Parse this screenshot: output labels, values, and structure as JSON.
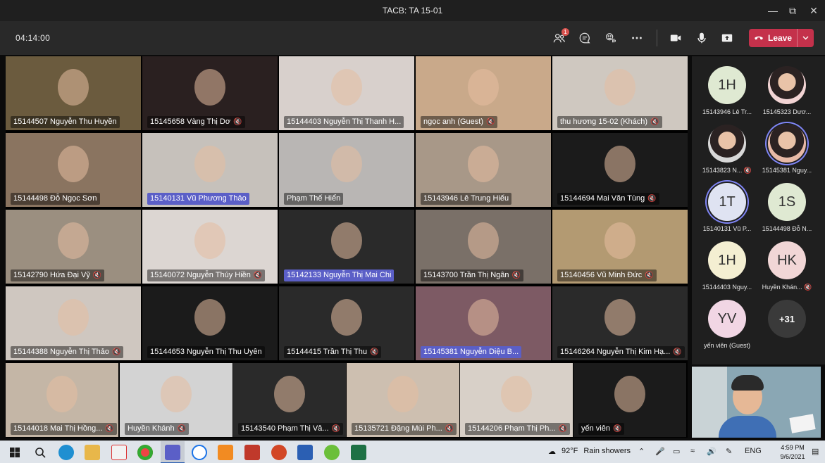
{
  "window": {
    "title": "TACB: TA 15-01"
  },
  "controls": {
    "timer": "04:14:00",
    "participants_badge": "1",
    "leave_label": "Leave"
  },
  "grid": {
    "tiles": [
      {
        "name": "15144507 Nguyễn Thu Huyền",
        "mic": false,
        "highlight": false
      },
      {
        "name": "15145658 Vàng Thị Dơ",
        "mic": true,
        "highlight": false
      },
      {
        "name": "15144403 Nguyễn Thị Thanh H...",
        "mic": false,
        "highlight": false
      },
      {
        "name": "ngọc anh (Guest)",
        "mic": true,
        "highlight": false
      },
      {
        "name": "thu hương 15-02 (Khách)",
        "mic": true,
        "highlight": false
      },
      {
        "name": "15144498 Đỗ Ngọc Sơn",
        "mic": false,
        "highlight": false
      },
      {
        "name": "15140131 Vũ Phương Thảo",
        "mic": false,
        "highlight": true
      },
      {
        "name": "Phạm Thế Hiển",
        "mic": false,
        "highlight": false
      },
      {
        "name": "15143946 Lê Trung Hiếu",
        "mic": false,
        "highlight": false
      },
      {
        "name": "15144694 Mai Văn Tùng",
        "mic": true,
        "highlight": false
      },
      {
        "name": "15142790 Hứa Đại Vỹ",
        "mic": true,
        "highlight": false
      },
      {
        "name": "15140072 Nguyễn Thúy Hiền",
        "mic": true,
        "highlight": false
      },
      {
        "name": "15142133 Nguyễn Thị Mai Chi",
        "mic": false,
        "highlight": true
      },
      {
        "name": "15143700 Trần Thị Ngân",
        "mic": true,
        "highlight": false
      },
      {
        "name": "15140456 Vũ Minh Đức",
        "mic": true,
        "highlight": false
      },
      {
        "name": "15144388 Nguyễn Thị Thảo",
        "mic": true,
        "highlight": false
      },
      {
        "name": "15144653 Nguyễn Thị Thu Uyên",
        "mic": false,
        "highlight": false
      },
      {
        "name": "15144415 Trần Thị Thu",
        "mic": true,
        "highlight": false
      },
      {
        "name": "15145381 Nguyễn Diệu B...",
        "mic": false,
        "highlight": true
      },
      {
        "name": "15146264 Nguyễn Thị Kim Hạ...",
        "mic": true,
        "highlight": false
      },
      {
        "name": "15144018 Mai Thị Hồng...",
        "mic": true,
        "highlight": false
      },
      {
        "name": "Huyền Khánh",
        "mic": true,
        "highlight": false
      },
      {
        "name": "15143540 Phạm Thị Vâ...",
        "mic": true,
        "highlight": false
      },
      {
        "name": "15135721 Đặng Mùi Ph...",
        "mic": true,
        "highlight": false
      },
      {
        "name": "15144206 Phạm Thị Ph...",
        "mic": true,
        "highlight": false
      },
      {
        "name": "yến viên",
        "mic": true,
        "highlight": false
      }
    ]
  },
  "roster": {
    "items": [
      {
        "initials": "1H",
        "label": "15143946 Lê Tr...",
        "color": "#dfe9d2",
        "photo": false,
        "speaking": false,
        "mic": false
      },
      {
        "initials": "",
        "label": "15145323 Dươ...",
        "color": "#f2d4d4",
        "photo": true,
        "speaking": false,
        "mic": false
      },
      {
        "initials": "",
        "label": "15143823 N...",
        "color": "#d8d8d8",
        "photo": true,
        "speaking": false,
        "mic": true
      },
      {
        "initials": "",
        "label": "15145381 Nguy...",
        "color": "#e8b9a6",
        "photo": true,
        "speaking": true,
        "mic": false
      },
      {
        "initials": "1T",
        "label": "15140131 Vũ P...",
        "color": "#dfe3f2",
        "photo": false,
        "speaking": true,
        "mic": false
      },
      {
        "initials": "1S",
        "label": "15144498 Đỗ N...",
        "color": "#dfe9d2",
        "photo": false,
        "speaking": false,
        "mic": false
      },
      {
        "initials": "1H",
        "label": "15144403 Nguy...",
        "color": "#f4efd2",
        "photo": false,
        "speaking": false,
        "mic": false
      },
      {
        "initials": "HK",
        "label": "Huyền Khán...",
        "color": "#f1d6d6",
        "photo": false,
        "speaking": false,
        "mic": true
      },
      {
        "initials": "YV",
        "label": "yến viên (Guest)",
        "color": "#f1d6e4",
        "photo": false,
        "speaking": false,
        "mic": false
      },
      {
        "initials": "+31",
        "label": "",
        "color": "#3a3a3a",
        "photo": false,
        "speaking": false,
        "mic": false
      }
    ]
  },
  "taskbar": {
    "weather_temp": "92°F",
    "weather_text": "Rain showers",
    "language": "ENG",
    "time": "4:59 PM",
    "date": "9/6/2021"
  }
}
